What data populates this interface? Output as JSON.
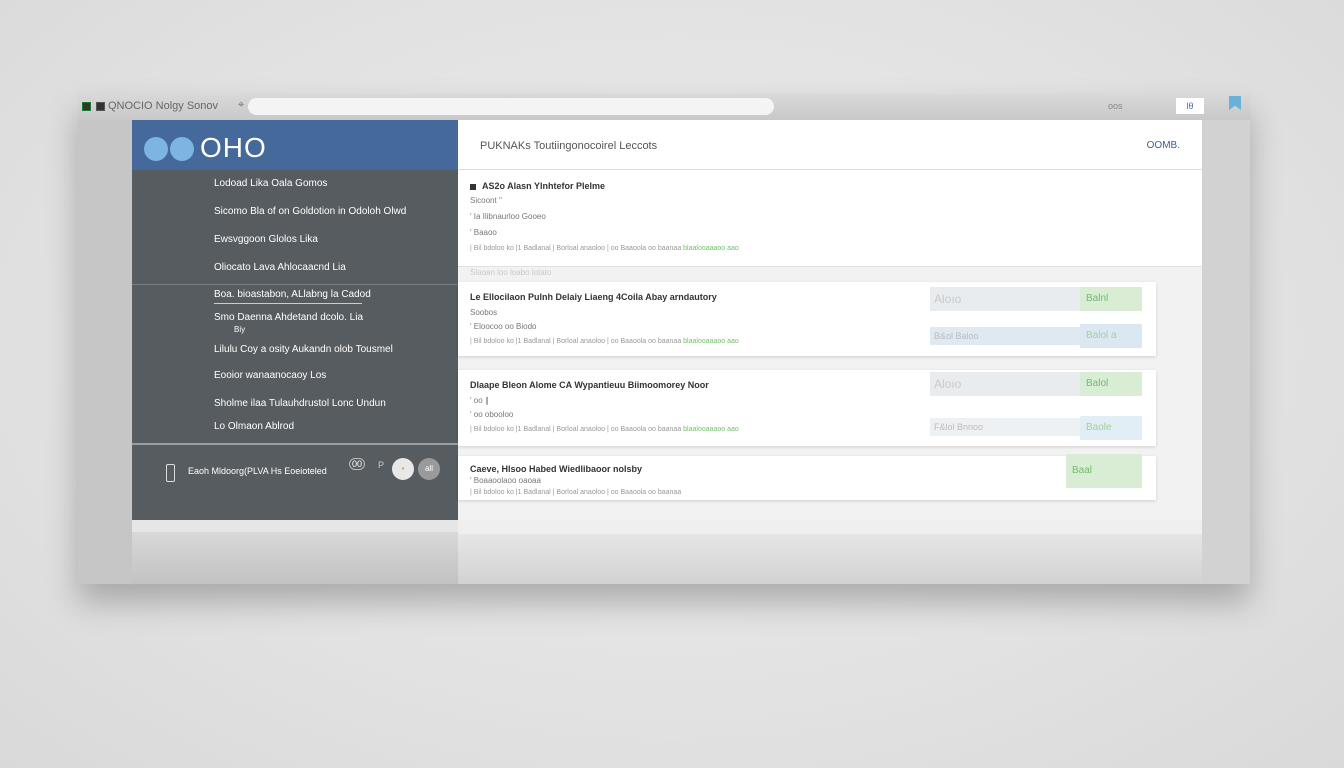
{
  "titlebar": {
    "title": "QNOCIO Nolgy Sonov",
    "glyph": "⌖",
    "right_text": "oos",
    "box_text": "lθ"
  },
  "sidebar": {
    "logo": "OHO",
    "items": [
      {
        "label": "Lodoad Lika Oala Gomos"
      },
      {
        "label": "Sicomo Bla of on Goldotion in Odoloh Olwd"
      },
      {
        "label": "Ewsvggoon Glolos Lika"
      },
      {
        "label": "Oliocato Lava Ahlocaacnd Lia"
      },
      {
        "label": "Boa. bioastabon, ALlabng la Cadod"
      },
      {
        "label": "Smo Daenna Ahdetand dcolo. Lia"
      },
      {
        "label": "Biy"
      },
      {
        "label": "Lilulu Coy a osity Aukandn olob Tousmel"
      },
      {
        "label": "Eooior wanaanocaoy Los"
      },
      {
        "label": "Sholme ilaa Tulauhdrustol Lonc Undun"
      },
      {
        "label": "Lo Olmaon Ablrod"
      }
    ],
    "user": {
      "label": "Eaoh Mldoorg(PLVA Hs Eoeioteled",
      "badge": "00",
      "glyph": "P",
      "pill1": "•",
      "pill2": "all"
    }
  },
  "main": {
    "title": "PUKNAKs Toutiingonocoirel Leccots",
    "action": "OOMB.",
    "cards": [
      {
        "title": "AS2o  Alasn Ylnhtefor Plelme",
        "line1": "Sicoont ''",
        "line2": "' Ia Ilibnaurloo Gooeo",
        "line3": "' Baaoo",
        "meta": "| Bil  bdoloo ko |1   Badlanal |  Borloal anaoloo | oo Baaoola      oo  baanaa    ",
        "meta_green": "blaalooaaaoo aao",
        "after": "Slaoan loo loabo   lotato"
      },
      {
        "title": "Le Ellocilaon Pulnh Delaiy Liaeng 4Coila Abay arndautory",
        "line1": "Soobos",
        "line2": "' Eloocoo oo Biodo",
        "meta": "| Bil  bdoloo ko |1   Badlanal |  Borloal anaoloo | oo Baaoola      oo  baanaa    ",
        "meta_green": "blaalooaaaoo aao",
        "score": "Aloıo",
        "badge": "Balnl",
        "tag": "B&ol Baloo",
        "tag_badge": "Balol a"
      },
      {
        "title": "Dlaape Bleon  Alome CA Wypantieuu  Biimoomorey Noor",
        "line1": "' oo  ∥",
        "line2": "' oo obooloo",
        "meta": "| Bil  bdoloo ko |1   Badlanal |  Borloal anaoloo | oo Baaoola      oo  baanaa    ",
        "meta_green": "blaalooaaaoo aao",
        "score": "Aloıo",
        "badge": "Balol",
        "tag": "F&lol Bnnoo",
        "tag_badge": "Baole"
      },
      {
        "title": "Caeve, Hlsoo Habed Wiedlibaoor nolsby",
        "line1": "' Boaaoolaoo  oaoaa",
        "meta": "| Bil  bdoloo ko |1   Badlanal |  Borloal anaoloo | oo Baaoola      oo  baanaa",
        "badge": "Baal"
      }
    ]
  }
}
